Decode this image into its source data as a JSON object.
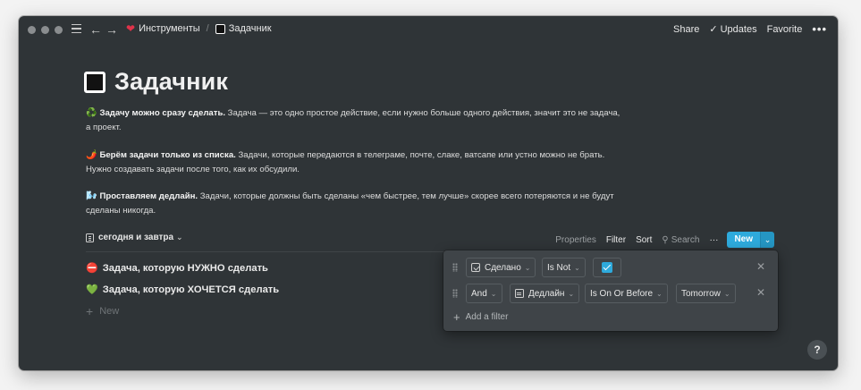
{
  "breadcrumb": {
    "parent_icon": "heart-icon",
    "parent": "Инструменты",
    "current_icon": "black-square-icon",
    "current": "Задачник"
  },
  "topbar": {
    "share": "Share",
    "updates": "Updates",
    "favorite": "Favorite",
    "more_icon": "more-icon"
  },
  "page": {
    "icon": "black-square-icon",
    "title": "Задачник",
    "paragraphs": [
      {
        "emoji": "♻️",
        "bold": "Задачу можно сразу сделать.",
        "text": " Задача — это одно простое действие, если нужно больше одного действия, значит это не задача, а проект."
      },
      {
        "emoji": "🌶️",
        "bold": "Берём задачи только из списка.",
        "text": " Задачи, которые передаются в телеграме, почте, слаке, ватсапе или устно можно не брать. Нужно создавать задачи после того, как их обсудили."
      },
      {
        "emoji": "🌬️",
        "bold": "Проставляем дедлайн.",
        "text": " Задачи, которые должны быть сделаны «чем быстрее, тем лучше» скорее всего потеряются и не будут сделаны никогда."
      }
    ]
  },
  "view": {
    "name": "сегодня и завтра",
    "toolbar": {
      "properties": "Properties",
      "filter": "Filter",
      "sort": "Sort",
      "search": "Search",
      "new": "New"
    }
  },
  "tasks": [
    {
      "emoji": "⛔",
      "title": "Задача, которую НУЖНО сделать"
    },
    {
      "emoji": "💚",
      "title": "Задача, которую ХОЧЕТСЯ сделать"
    }
  ],
  "new_row": "New",
  "filters": {
    "row1": {
      "property": "Сделано",
      "operator": "Is Not",
      "checked": true
    },
    "row2": {
      "conjunction": "And",
      "property": "Дедлайн",
      "operator": "Is On Or Before",
      "value": "Tomorrow"
    },
    "add": "Add a filter"
  },
  "help": "?",
  "colors": {
    "accent": "#2eaadc",
    "background": "#2f3437"
  }
}
